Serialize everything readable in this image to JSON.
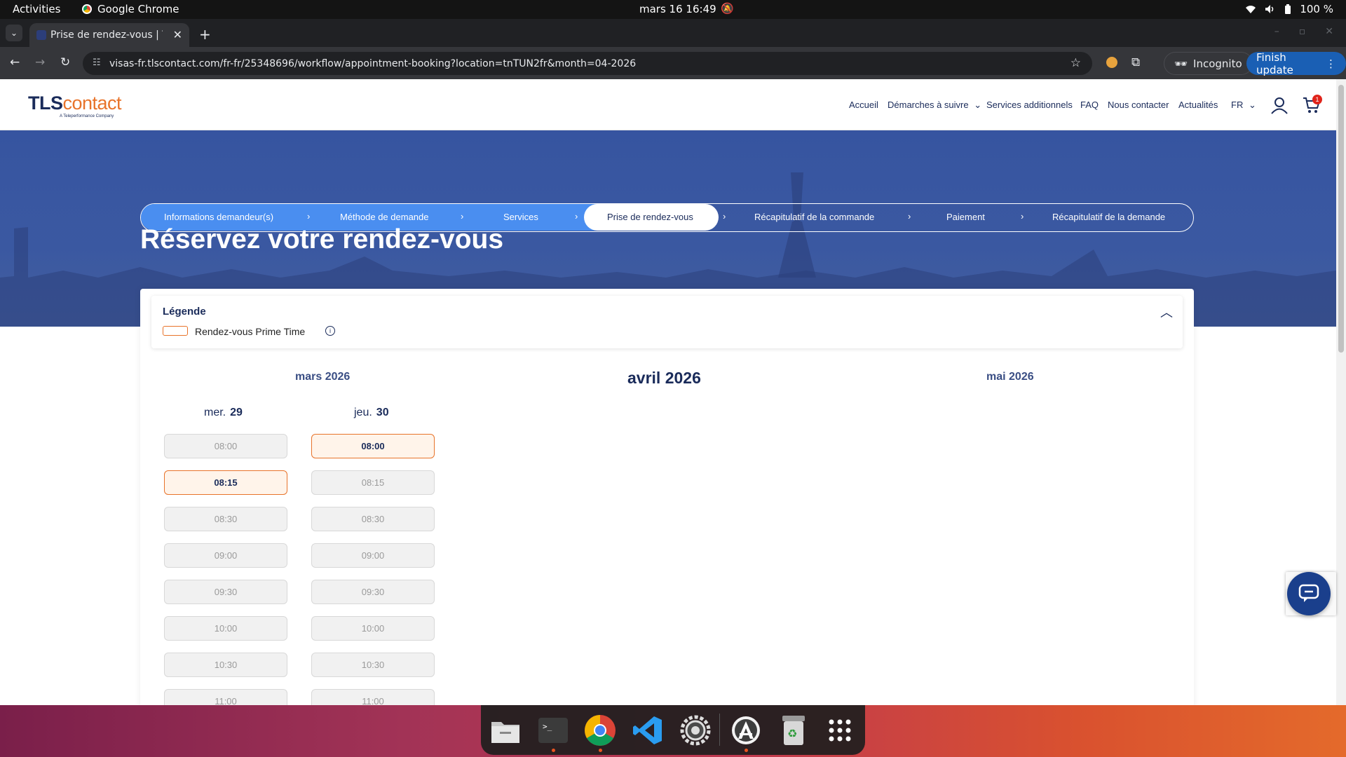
{
  "system_bar": {
    "activities": "Activities",
    "app_name": "Google Chrome",
    "clock": "mars 16  16:49",
    "battery": "100 %"
  },
  "browser": {
    "tab_title": "Prise de rendez-vous | TLS",
    "url": "visas-fr.tlscontact.com/fr-fr/25348696/workflow/appointment-booking?location=tnTUN2fr&month=04-2026",
    "incognito_label": "Incognito",
    "finish_update_label": "Finish update"
  },
  "site": {
    "logo_main": "TLS",
    "logo_accent": "contact",
    "logo_tagline": "A Teleperformance Company",
    "nav": {
      "accueil": "Accueil",
      "demarches": "Démarches à suivre",
      "services": "Services additionnels",
      "faq": "FAQ",
      "contact": "Nous contacter",
      "actualites": "Actualités",
      "lang": "FR"
    },
    "cart_count": "1",
    "brand_colors": {
      "navy": "#1a2b5a",
      "orange": "#e8732a",
      "step_blue": "#4a8ef0"
    }
  },
  "steps": [
    "Informations demandeur(s)",
    "Méthode de demande",
    "Services",
    "Prise de rendez-vous",
    "Récapitulatif de la commande",
    "Paiement",
    "Récapitulatif de la demande"
  ],
  "current_step": 3,
  "page_title": "Réservez votre rendez-vous",
  "legend": {
    "title": "Légende",
    "prime_time_label": "Rendez-vous Prime Time"
  },
  "months": {
    "prev": "mars 2026",
    "current": "avril 2026",
    "next": "mai 2026"
  },
  "days": [
    {
      "weekday": "mer.",
      "date": "29",
      "slots": [
        {
          "time": "08:00",
          "available": false
        },
        {
          "time": "08:15",
          "available": true
        },
        {
          "time": "08:30",
          "available": false
        },
        {
          "time": "09:00",
          "available": false
        },
        {
          "time": "09:30",
          "available": false
        },
        {
          "time": "10:00",
          "available": false
        },
        {
          "time": "10:30",
          "available": false
        },
        {
          "time": "11:00",
          "available": false
        }
      ]
    },
    {
      "weekday": "jeu.",
      "date": "30",
      "slots": [
        {
          "time": "08:00",
          "available": true
        },
        {
          "time": "08:15",
          "available": false
        },
        {
          "time": "08:30",
          "available": false
        },
        {
          "time": "09:00",
          "available": false
        },
        {
          "time": "09:30",
          "available": false
        },
        {
          "time": "10:00",
          "available": false
        },
        {
          "time": "10:30",
          "available": false
        },
        {
          "time": "11:00",
          "available": false
        }
      ]
    }
  ],
  "dock_apps": [
    "files-icon",
    "terminal-icon",
    "chrome-icon",
    "vscode-icon",
    "settings-icon",
    "software-center-icon",
    "trash-icon",
    "app-grid-icon"
  ]
}
